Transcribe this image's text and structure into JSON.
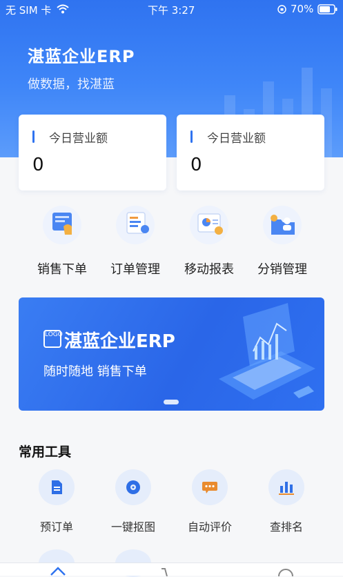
{
  "status_bar": {
    "carrier": "无 SIM 卡",
    "time": "下午 3:27",
    "battery": "70%"
  },
  "header": {
    "brand": "湛蓝企业ERP",
    "slogan": "做数据，找湛蓝"
  },
  "stats": [
    {
      "label": "今日营业额",
      "value": "0"
    },
    {
      "label": "今日营业额",
      "value": "0"
    }
  ],
  "quick_actions": [
    {
      "label": "销售下单",
      "icon": "sales-order-icon"
    },
    {
      "label": "订单管理",
      "icon": "order-management-icon"
    },
    {
      "label": "移动报表",
      "icon": "mobile-report-icon"
    },
    {
      "label": "分销管理",
      "icon": "distribution-icon"
    }
  ],
  "banner": {
    "logo_text": "LOGO",
    "title": "湛蓝企业ERP",
    "subtitle": "随时随地 销售下单"
  },
  "tools": {
    "title": "常用工具",
    "items": [
      {
        "label": "预订单",
        "icon": "document-icon"
      },
      {
        "label": "一键抠图",
        "icon": "disc-icon"
      },
      {
        "label": "自动评价",
        "icon": "comment-icon"
      },
      {
        "label": "查排名",
        "icon": "bar-chart-icon"
      }
    ]
  },
  "colors": {
    "primary": "#2f73f0",
    "background": "#f6f7f9"
  }
}
